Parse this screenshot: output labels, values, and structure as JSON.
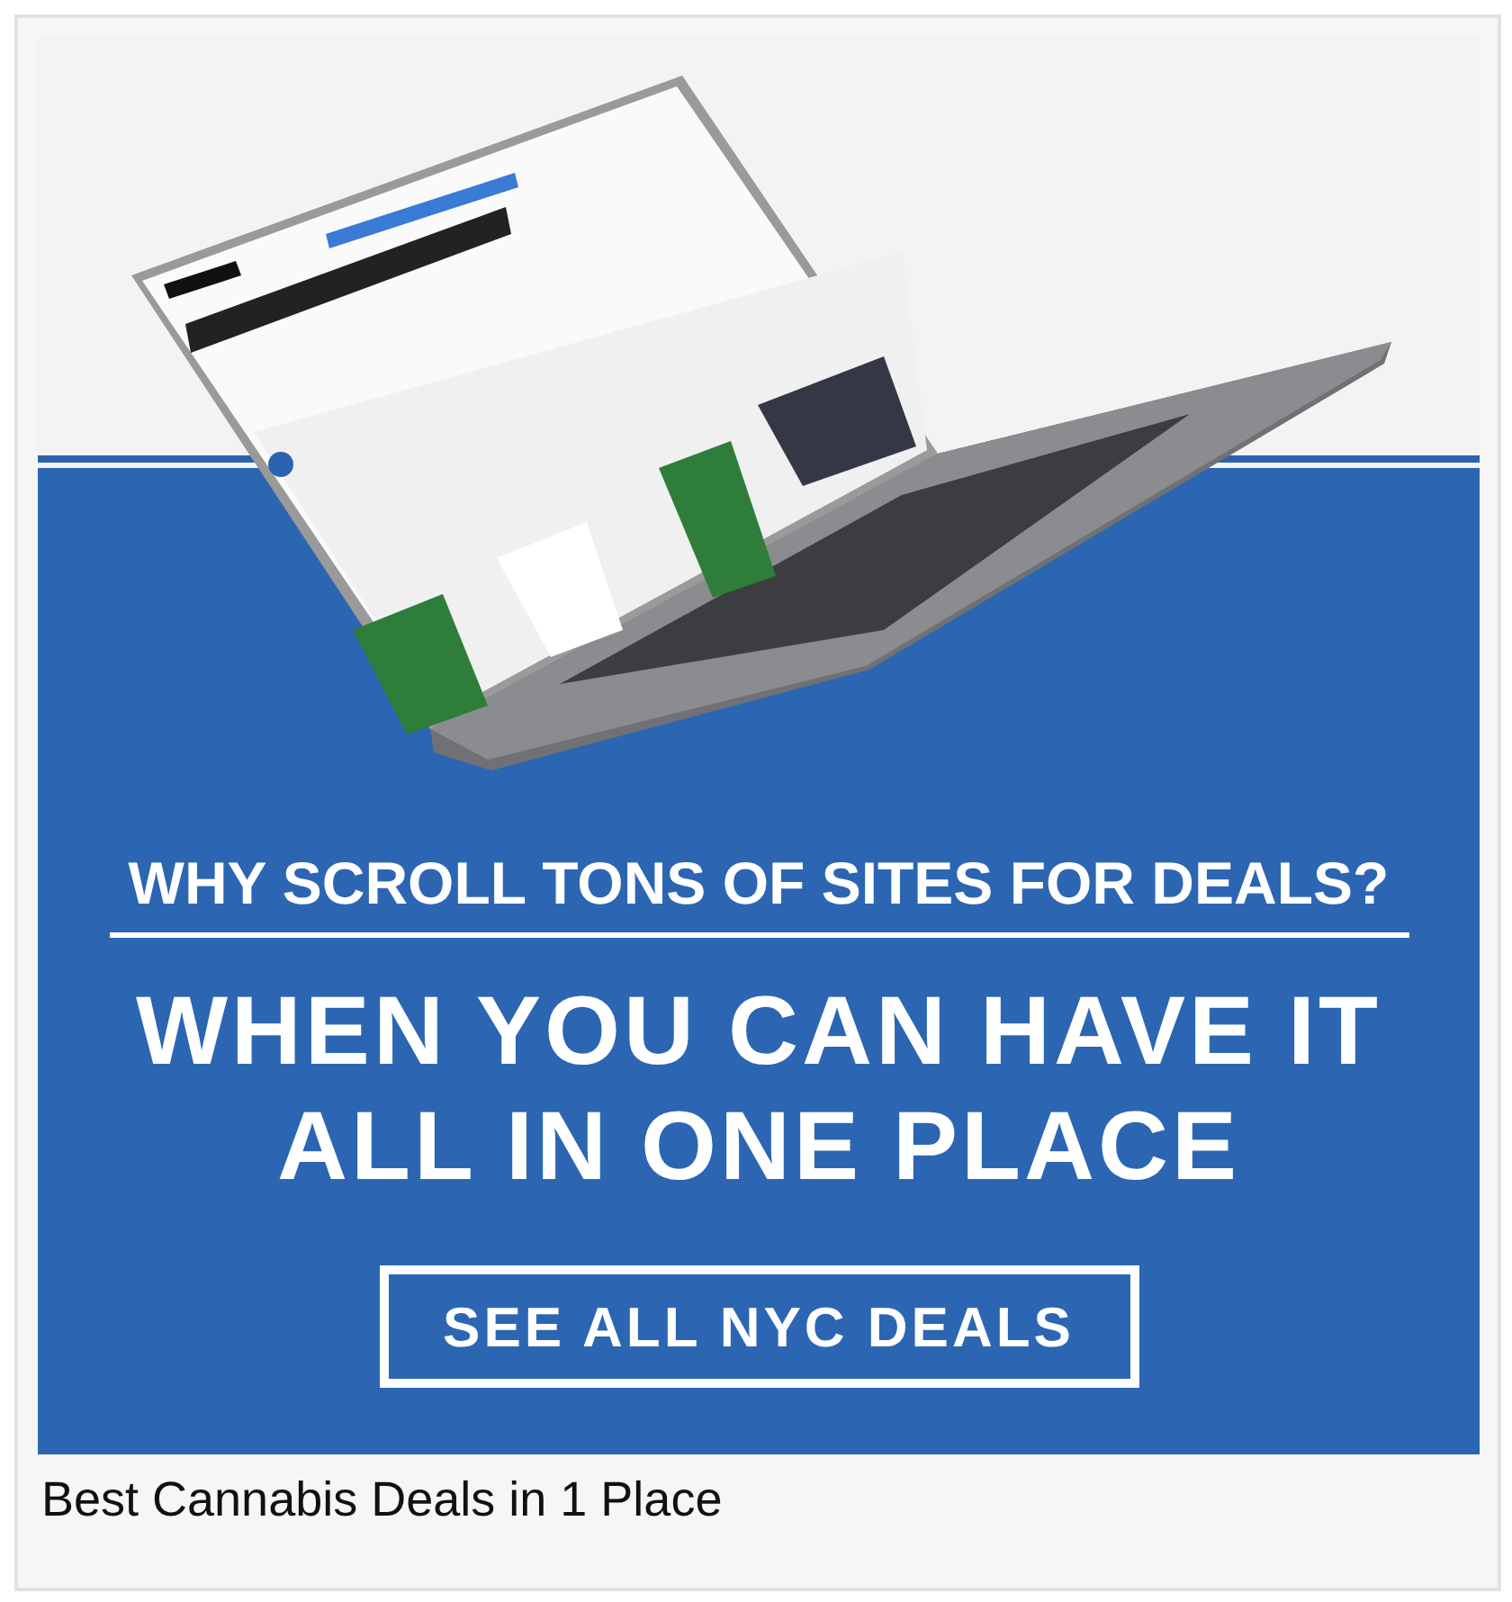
{
  "ad": {
    "question": "WHY SCROLL TONS OF SITES FOR DEALS?",
    "headline": "WHEN YOU CAN HAVE IT ALL IN ONE PLACE",
    "button": "SEE ALL NYC DEALS"
  },
  "caption": "Best Cannabis Deals in 1 Place"
}
